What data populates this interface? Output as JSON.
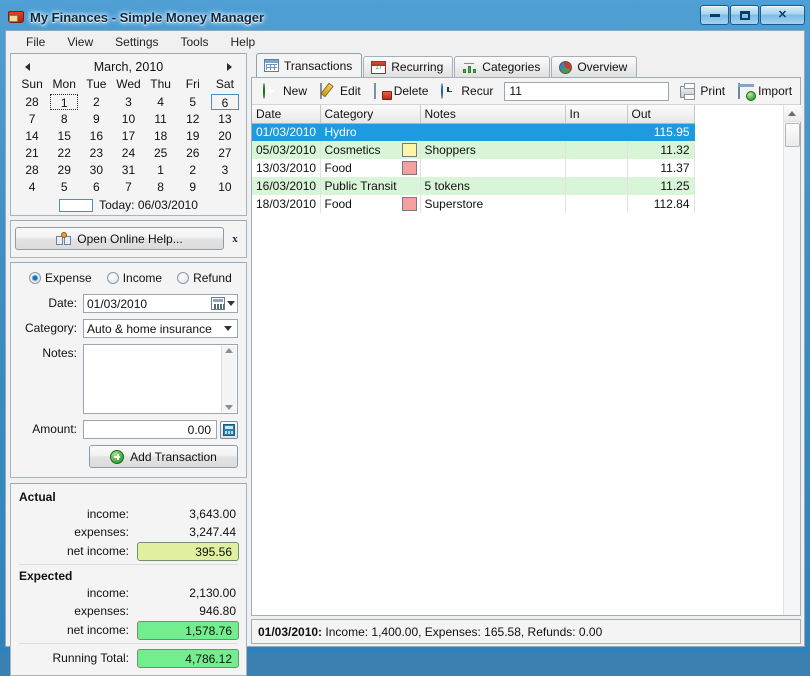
{
  "window": {
    "title": "My Finances - Simple Money Manager",
    "icon": "wallet-icon",
    "minimize_label": "Minimize",
    "maximize_label": "Maximize",
    "close_label": "Close"
  },
  "menubar": {
    "items": [
      {
        "label": "File"
      },
      {
        "label": "View"
      },
      {
        "label": "Settings"
      },
      {
        "label": "Tools"
      },
      {
        "label": "Help"
      }
    ]
  },
  "calendar": {
    "month_label": "March, 2010",
    "prev_label": "Previous month",
    "next_label": "Next month",
    "weekdays": [
      "Sun",
      "Mon",
      "Tue",
      "Wed",
      "Thu",
      "Fri",
      "Sat"
    ],
    "weeks": [
      [
        {
          "d": "28",
          "dim": true
        },
        {
          "d": "1",
          "focus": true
        },
        {
          "d": "2"
        },
        {
          "d": "3"
        },
        {
          "d": "4"
        },
        {
          "d": "5"
        },
        {
          "d": "6",
          "today": true
        }
      ],
      [
        {
          "d": "7"
        },
        {
          "d": "8"
        },
        {
          "d": "9"
        },
        {
          "d": "10"
        },
        {
          "d": "11"
        },
        {
          "d": "12"
        },
        {
          "d": "13"
        }
      ],
      [
        {
          "d": "14"
        },
        {
          "d": "15"
        },
        {
          "d": "16"
        },
        {
          "d": "17"
        },
        {
          "d": "18"
        },
        {
          "d": "19"
        },
        {
          "d": "20"
        }
      ],
      [
        {
          "d": "21"
        },
        {
          "d": "22"
        },
        {
          "d": "23"
        },
        {
          "d": "24"
        },
        {
          "d": "25"
        },
        {
          "d": "26"
        },
        {
          "d": "27"
        }
      ],
      [
        {
          "d": "28"
        },
        {
          "d": "29"
        },
        {
          "d": "30"
        },
        {
          "d": "31"
        },
        {
          "d": "1",
          "dim": true
        },
        {
          "d": "2",
          "dim": true
        },
        {
          "d": "3",
          "dim": true
        }
      ],
      [
        {
          "d": "4",
          "dim": true
        },
        {
          "d": "5",
          "dim": true
        },
        {
          "d": "6",
          "dim": true
        },
        {
          "d": "7",
          "dim": true
        },
        {
          "d": "8",
          "dim": true
        },
        {
          "d": "9",
          "dim": true
        },
        {
          "d": "10",
          "dim": true
        }
      ]
    ],
    "today_text": "Today: 06/03/2010"
  },
  "help_strip": {
    "button_label": "Open Online Help...",
    "button_icon": "book-help-icon",
    "close_label": "x"
  },
  "form": {
    "type_options": [
      {
        "label": "Expense",
        "selected": true
      },
      {
        "label": "Income",
        "selected": false
      },
      {
        "label": "Refund",
        "selected": false
      }
    ],
    "date_label": "Date:",
    "date_value": "01/03/2010",
    "date_picker_icon": "calendar-picker-icon",
    "category_label": "Category:",
    "category_value": "Auto & home insurance",
    "notes_label": "Notes:",
    "notes_value": "",
    "amount_label": "Amount:",
    "amount_value": "0.00",
    "calculator_icon": "calculator-icon",
    "add_button_label": "Add Transaction",
    "add_button_icon": "plus-circle-icon"
  },
  "summary": {
    "actual_heading": "Actual",
    "actual_income_label": "income:",
    "actual_income_value": "3,643.00",
    "actual_expenses_label": "expenses:",
    "actual_expenses_value": "3,247.44",
    "actual_net_label": "net income:",
    "actual_net_value": "395.56",
    "expected_heading": "Expected",
    "expected_income_label": "income:",
    "expected_income_value": "2,130.00",
    "expected_expenses_label": "expenses:",
    "expected_expenses_value": "946.80",
    "expected_net_label": "net income:",
    "expected_net_value": "1,578.76",
    "running_total_label": "Running Total:",
    "running_total_value": "4,786.12",
    "colors": {
      "actual_net_bg": "#dff0a0",
      "expected_net_bg": "#72ee8e",
      "running_total_bg": "#72ee8e"
    }
  },
  "tabs": [
    {
      "label": "Transactions",
      "icon": "grid-table-icon",
      "active": true
    },
    {
      "label": "Recurring",
      "icon": "calendar-icon",
      "active": false
    },
    {
      "label": "Categories",
      "icon": "bar-chart-icon",
      "active": false
    },
    {
      "label": "Overview",
      "icon": "pie-chart-icon",
      "active": false
    }
  ],
  "toolbar": {
    "new_label": "New",
    "new_icon": "add-circle-icon",
    "edit_label": "Edit",
    "edit_icon": "pencil-page-icon",
    "delete_label": "Delete",
    "delete_icon": "delete-page-icon",
    "recur_label": "Recur",
    "recur_icon": "clock-icon",
    "search_value": "11",
    "search_placeholder": "",
    "print_label": "Print",
    "print_icon": "printer-icon",
    "import_label": "Import",
    "import_icon": "import-page-icon"
  },
  "transactions": {
    "columns": [
      "Date",
      "Category",
      "Notes",
      "In",
      "Out"
    ],
    "rows": [
      {
        "date": "01/03/2010",
        "category": "Hydro",
        "swatch": "",
        "notes": "",
        "in": "",
        "out": "115.95",
        "selected": true,
        "alt": false
      },
      {
        "date": "05/03/2010",
        "category": "Cosmetics",
        "swatch": "#fbf6a8",
        "notes": "Shoppers",
        "in": "",
        "out": "11.32",
        "selected": false,
        "alt": true
      },
      {
        "date": "13/03/2010",
        "category": "Food",
        "swatch": "#f5a0a0",
        "notes": "",
        "in": "",
        "out": "11.37",
        "selected": false,
        "alt": false
      },
      {
        "date": "16/03/2010",
        "category": "Public Transit",
        "swatch": "",
        "notes": "5 tokens",
        "in": "",
        "out": "11.25",
        "selected": false,
        "alt": true
      },
      {
        "date": "18/03/2010",
        "category": "Food",
        "swatch": "#f5a0a0",
        "notes": "Superstore",
        "in": "",
        "out": "112.84",
        "selected": false,
        "alt": false
      }
    ],
    "selected_row_color": "#1e9be0",
    "alt_row_color": "#d8f5d8"
  },
  "statusbar": {
    "date": "01/03/2010:",
    "text": "Income: 1,400.00, Expenses: 165.58, Refunds: 0.00"
  }
}
